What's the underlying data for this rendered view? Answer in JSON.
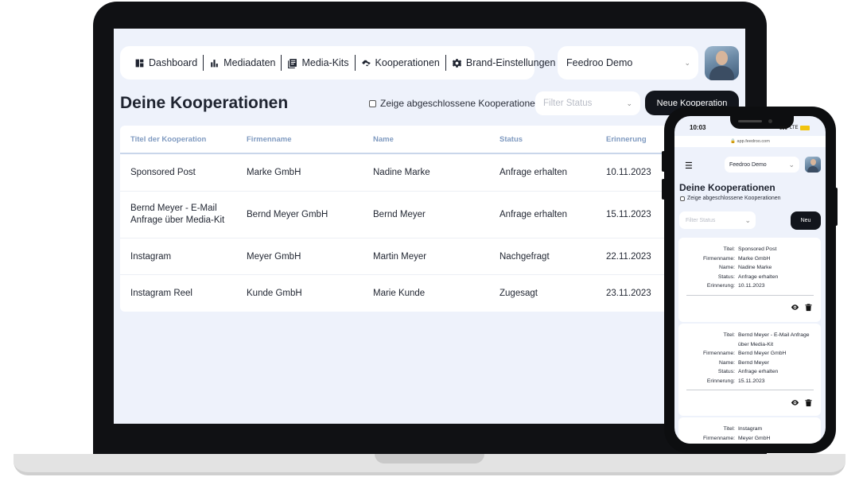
{
  "nav": {
    "items": [
      {
        "label": "Dashboard",
        "icon": "dashboard-icon"
      },
      {
        "label": "Mediadaten",
        "icon": "bar-chart-icon"
      },
      {
        "label": "Media-Kits",
        "icon": "library-icon"
      },
      {
        "label": "Kooperationen",
        "icon": "handshake-icon"
      },
      {
        "label": "Brand-Einstellungen",
        "icon": "gear-icon"
      }
    ]
  },
  "brand_select": {
    "value": "Feedroo Demo"
  },
  "page": {
    "title": "Deine Kooperationen",
    "checkbox_label": "Zeige abgeschlossene Kooperationen",
    "filter_placeholder": "Filter Status",
    "new_button": "Neue Kooperation"
  },
  "table": {
    "headers": [
      "Titel der Kooperation",
      "Firmenname",
      "Name",
      "Status",
      "Erinnerung"
    ],
    "rows": [
      [
        "Sponsored Post",
        "Marke GmbH",
        "Nadine Marke",
        "Anfrage erhalten",
        "10.11.2023"
      ],
      [
        "Bernd Meyer - E-Mail Anfrage über Media-Kit",
        "Bernd Meyer GmbH",
        "Bernd Meyer",
        "Anfrage erhalten",
        "15.11.2023"
      ],
      [
        "Instagram",
        "Meyer GmbH",
        "Martin Meyer",
        "Nachgefragt",
        "22.11.2023"
      ],
      [
        "Instagram Reel",
        "Kunde GmbH",
        "Marie Kunde",
        "Zugesagt",
        "23.11.2023"
      ]
    ]
  },
  "mobile": {
    "time": "10:03",
    "network": "LTE",
    "url": "app.feedroo.com",
    "brand_value": "Feedroo Demo",
    "title": "Deine Kooperationen",
    "checkbox_label": "Zeige abgeschlossene Kooperationen",
    "filter_placeholder": "Filter Status",
    "new_button": "Neu",
    "labels": {
      "title": "Titel:",
      "company": "Firmenname:",
      "name": "Name:",
      "status": "Status:",
      "reminder": "Erinnerung:"
    },
    "cards": [
      {
        "title": "Sponsored Post",
        "company": "Marke GmbH",
        "name": "Nadine Marke",
        "status": "Anfrage erhalten",
        "reminder": "10.11.2023"
      },
      {
        "title": "Bernd Meyer - E-Mail Anfrage über Media-Kit",
        "company": "Bernd Meyer GmbH",
        "name": "Bernd Meyer",
        "status": "Anfrage erhalten",
        "reminder": "15.11.2023"
      },
      {
        "title": "Instagram",
        "company": "Meyer GmbH"
      }
    ]
  }
}
